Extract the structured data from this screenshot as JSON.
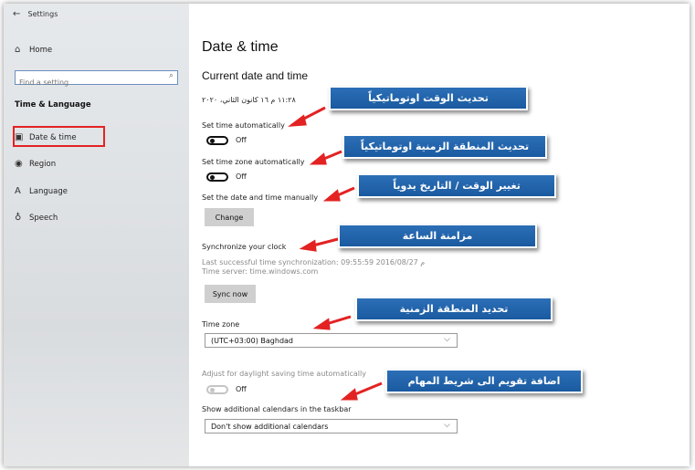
{
  "window": {
    "back_glyph": "←",
    "title": "Settings"
  },
  "sidebar": {
    "home_label": "Home",
    "search_placeholder": "Find a setting",
    "section_title": "Time & Language",
    "items": [
      {
        "label": "Date & time",
        "icon": "date-time-icon"
      },
      {
        "label": "Region",
        "icon": "globe-icon"
      },
      {
        "label": "Language",
        "icon": "language-icon"
      },
      {
        "label": "Speech",
        "icon": "microphone-icon"
      }
    ]
  },
  "main": {
    "title": "Date & time",
    "subtitle": "Current date and time",
    "current_datetime": "١١:٢٨ م ١٦ كانون الثاني، ٢٠٢٠",
    "set_time_auto": {
      "label": "Set time automatically",
      "state": "Off"
    },
    "set_zone_auto": {
      "label": "Set time zone automatically",
      "state": "Off"
    },
    "manual_label": "Set the date and time manually",
    "change_button": "Change",
    "sync_heading": "Synchronize your clock",
    "last_sync": "Last successful time synchronization: 09:55:59 م 2016/08/27",
    "time_server": "Time server: time.windows.com",
    "sync_button": "Sync now",
    "timezone_label": "Time zone",
    "timezone_value": "(UTC+03:00) Baghdad",
    "dst": {
      "label": "Adjust for daylight saving time automatically",
      "state": "Off"
    },
    "calendars_label": "Show additional calendars in the taskbar",
    "calendars_value": "Don't show additional calendars"
  },
  "callouts": [
    "تحديث الوقت اوتوماتيكياً",
    "تحديث المنطقة الزمنية اوتوماتيكياً",
    "تغيير الوقت / التاريخ يدوياً",
    "مزامنة الساعة",
    "تحديد المنطقة الزمنية",
    "اضافة تقويم الى شريط المهام"
  ],
  "colors": {
    "highlight": "#e32222",
    "callout_bg": "#1f63a9",
    "arrow": "#e32222"
  }
}
